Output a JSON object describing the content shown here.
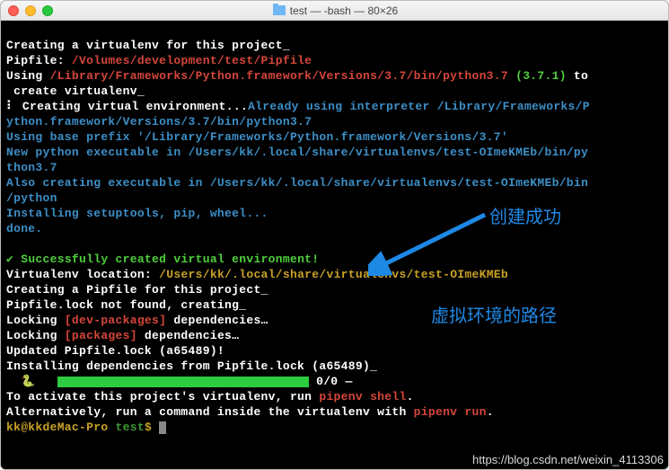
{
  "titlebar": {
    "title": "test — -bash — 80×26"
  },
  "annotations": {
    "success": "创建成功",
    "venv_path": "虚拟环境的路径"
  },
  "watermark": "https://blog.csdn.net/weixin_4113306",
  "segments": {
    "l1a": "Creating a virtualenv for this project_",
    "l2a": "Pipfile: ",
    "l2b": "/Volumes/development/test/Pipfile",
    "l3a": "Using ",
    "l3b": "/Library/Frameworks/Python.framework/Versions/3.7/bin/python3.7",
    "l3c": " (3.7.1)",
    "l3d": " to",
    "l4a": " create virtualenv_",
    "l5a": "⠇ Creating virtual environment...",
    "l5b": "Already using interpreter /Library/Frameworks/P",
    "l6a": "ython.framework/Versions/3.7/bin/python3.7",
    "l7a": "Using base prefix '/Library/Frameworks/Python.framework/Versions/3.7'",
    "l8a": "New python executable in /Users/kk/.local/share/virtualenvs/test-OImeKMEb/bin/py",
    "l9a": "thon3.7",
    "l10a": "Also creating executable in /Users/kk/.local/share/virtualenvs/test-OImeKMEb/bin",
    "l11a": "/python",
    "l12a": "Installing setuptools, pip, wheel...",
    "l13a": "done.",
    "l14": "",
    "l15a": "✔ Successfully created virtual environment!",
    "l16a": "Virtualenv location: ",
    "l16b": "/Users/kk/.local/share/virtualenvs/test-OImeKMEb",
    "l17a": "Creating a Pipfile for this project_",
    "l18a": "Pipfile.lock not found, creating_",
    "l19a": "Locking ",
    "l19b": "[dev-packages]",
    "l19c": " dependencies…",
    "l20a": "Locking ",
    "l20b": "[packages]",
    "l20c": " dependencies…",
    "l21a": "Updated Pipfile.lock (a65489)!",
    "l22a": "Installing dependencies from Pipfile.lock (a65489)_",
    "l23a": "  🐍   ",
    "l23b": " 0/0 — ",
    "l24a": "To activate this project's virtualenv, run ",
    "l24b": "pipenv shell",
    "l24c": ".",
    "l25a": "Alternatively, run a command inside the virtualenv with ",
    "l25b": "pipenv run",
    "l25c": ".",
    "l26a": "kk@kkdeMac-Pro ",
    "l26b": "test",
    "l26c": "$ "
  }
}
